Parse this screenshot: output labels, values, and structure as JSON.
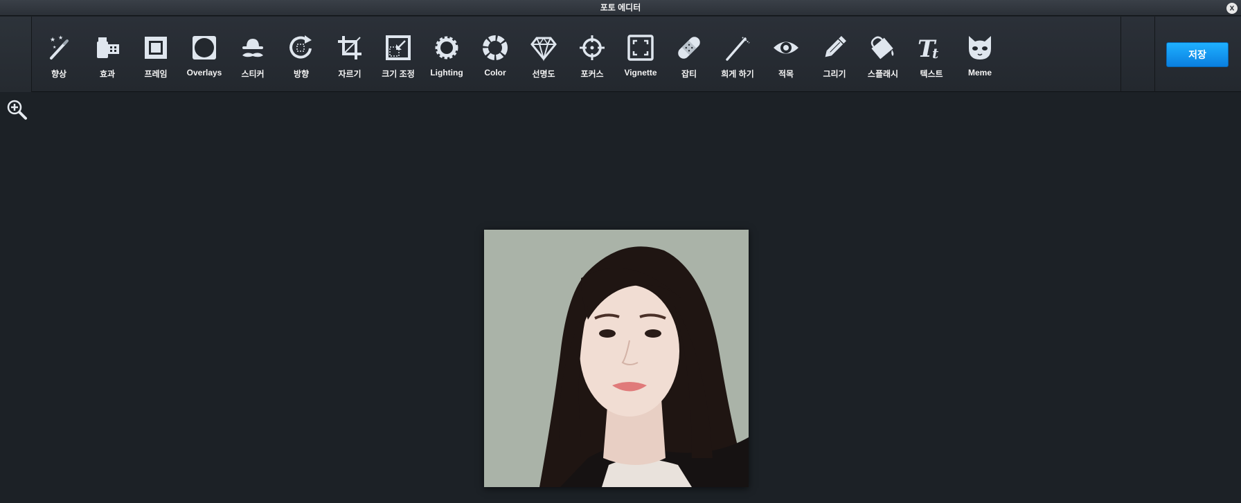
{
  "window": {
    "title": "포토 에디터",
    "close_glyph": "x"
  },
  "toolbar": {
    "tools": [
      {
        "label": "향상",
        "icon": "magic-wand-icon"
      },
      {
        "label": "효과",
        "icon": "film-camera-icon"
      },
      {
        "label": "프레임",
        "icon": "frame-icon"
      },
      {
        "label": "Overlays",
        "icon": "overlay-icon"
      },
      {
        "label": "스티커",
        "icon": "hat-mustache-icon"
      },
      {
        "label": "방향",
        "icon": "rotate-icon"
      },
      {
        "label": "자르기",
        "icon": "crop-icon"
      },
      {
        "label": "크기 조정",
        "icon": "resize-icon"
      },
      {
        "label": "Lighting",
        "icon": "sun-icon"
      },
      {
        "label": "Color",
        "icon": "color-wheel-icon"
      },
      {
        "label": "선명도",
        "icon": "diamond-icon"
      },
      {
        "label": "포커스",
        "icon": "focus-target-icon"
      },
      {
        "label": "Vignette",
        "icon": "vignette-icon"
      },
      {
        "label": "잡티",
        "icon": "bandage-icon"
      },
      {
        "label": "희게 하기",
        "icon": "toothbrush-icon"
      },
      {
        "label": "적목",
        "icon": "eye-icon"
      },
      {
        "label": "그리기",
        "icon": "pencil-icon"
      },
      {
        "label": "스플래시",
        "icon": "paint-bucket-icon"
      },
      {
        "label": "텍스트",
        "icon": "text-icon"
      },
      {
        "label": "Meme",
        "icon": "cat-face-icon"
      }
    ],
    "save_label": "저장"
  },
  "canvas": {
    "zoom_icon": "zoom-in-icon"
  },
  "colors": {
    "accent": "#0a8fef",
    "background": "#1c2126",
    "icon": "#dfe6ee"
  }
}
